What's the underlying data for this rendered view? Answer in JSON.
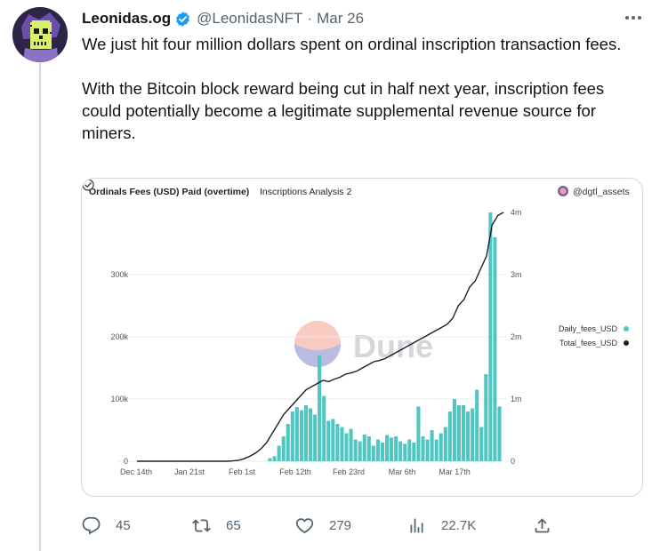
{
  "tweet": {
    "author_name": "Leonidas.og",
    "handle": "@LeonidasNFT",
    "separator": "·",
    "date": "Mar 26",
    "text": [
      "We just hit four million dollars spent on ordinal inscription transaction fees.",
      "With the Bitcoin block reward being cut in half next year, inscription fees could potentially become a legitimate supplemental revenue source for miners."
    ]
  },
  "media": {
    "title": "Ordinals Fees (USD) Paid (overtime)",
    "subtitle": "Inscriptions Analysis 2",
    "credit": "@dgtl_assets",
    "watermark": "Dune",
    "colors": {
      "bars": "#4fc6c1",
      "line": "#1a1f2b",
      "grid": "#e9ebee",
      "axis_text": "#555555"
    }
  },
  "chart_data": {
    "type": "bar",
    "title": "Ordinals Fees (USD) Paid (overtime)",
    "x_tick_labels": [
      "Dec 14th",
      "Jan 21st",
      "Feb 1st",
      "Feb 12th",
      "Feb 23rd",
      "Mar 6th",
      "Mar 17th"
    ],
    "y_left_tick_labels": [
      "0",
      "100k",
      "200k",
      "300k"
    ],
    "y_right_tick_labels": [
      "0",
      "1m",
      "2m",
      "3m",
      "4m"
    ],
    "ylim_left": [
      0,
      400000
    ],
    "ylim_right": [
      0,
      4000000
    ],
    "legend_position": "right",
    "grid": true,
    "series": [
      {
        "name": "Daily_fees_USD",
        "type": "bar",
        "color": "#4fc6c1",
        "values": [
          5000,
          8000,
          25000,
          40000,
          60000,
          80000,
          87000,
          82000,
          90000,
          85000,
          75000,
          170000,
          105000,
          65000,
          68000,
          60000,
          55000,
          45000,
          52000,
          35000,
          32000,
          43000,
          40000,
          25000,
          35000,
          30000,
          42000,
          38000,
          40000,
          32000,
          28000,
          35000,
          30000,
          88000,
          40000,
          35000,
          50000,
          35000,
          45000,
          55000,
          80000,
          100000,
          90000,
          90000,
          80000,
          85000,
          115000,
          55000,
          140000,
          410000,
          360000,
          88000
        ]
      },
      {
        "name": "Total_fees_USD",
        "type": "line",
        "color": "#1a1f2b",
        "values": [
          0,
          0,
          0,
          0,
          0,
          0,
          0,
          0,
          0,
          0,
          0,
          0,
          0,
          0,
          0,
          0,
          0,
          5000,
          15000,
          40000,
          80000,
          130000,
          200000,
          300000,
          450000,
          600000,
          750000,
          850000,
          950000,
          1050000,
          1150000,
          1200000,
          1250000,
          1300000,
          1280000,
          1320000,
          1350000,
          1400000,
          1420000,
          1450000,
          1500000,
          1550000,
          1600000,
          1620000,
          1650000,
          1700000,
          1750000,
          1800000,
          1850000,
          1900000,
          1950000,
          2000000,
          2050000,
          2100000,
          2150000,
          2200000,
          2300000,
          2500000,
          2600000,
          2800000,
          2900000,
          3100000,
          3300000,
          3800000,
          3950000,
          4000000
        ]
      }
    ]
  },
  "actions": {
    "replies": "45",
    "retweets": "65",
    "likes": "279",
    "views": "22.7K"
  }
}
